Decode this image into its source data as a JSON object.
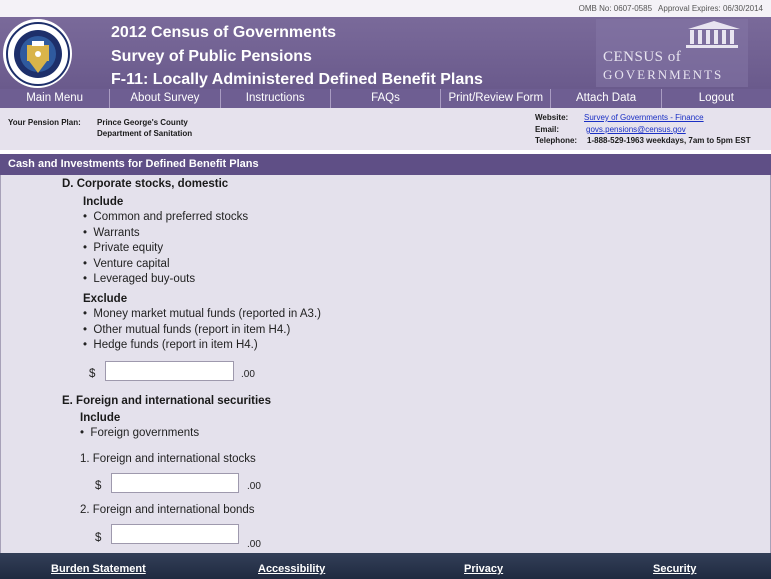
{
  "omb": {
    "number": "OMB No:  0607-0585",
    "expires": "Approval Expires:  06/30/2014"
  },
  "header": {
    "line1": "2012 Census of Governments",
    "line2": "Survey of Public Pensions",
    "line3": "F-11:  Locally Administered Defined Benefit Plans",
    "logo_line1": "CENSUS of",
    "logo_line2": "GOVERNMENTS"
  },
  "nav": [
    "Main Menu",
    "About Survey",
    "Instructions",
    "FAQs",
    "Print/Review Form",
    "Attach Data",
    "Logout"
  ],
  "plan": {
    "label": "Your Pension Plan:",
    "name1": "Prince George's County",
    "name2": "Department of Sanitation"
  },
  "contact": {
    "website_label": "Website:",
    "website": "Survey of Governments - Finance",
    "email_label": "Email:",
    "email": "govs.pensions@census.gov",
    "phone_label": "Telephone:",
    "phone": "1-888-529-1963  weekdays, 7am to 5pm EST"
  },
  "section_title": "Cash and Investments for Defined Benefit Plans",
  "item_d": {
    "title": "D.  Corporate stocks, domestic",
    "include_label": "Include",
    "include": [
      "Common and preferred stocks",
      "Warrants",
      "Private equity",
      "Venture capital",
      "Leveraged buy-outs"
    ],
    "exclude_label": "Exclude",
    "exclude": [
      "Money market mutual funds (reported in A3.)",
      "Other mutual funds (report in item H4.)",
      "Hedge funds (report in item H4.)"
    ],
    "currency": "$",
    "value": "",
    "cents": ".00"
  },
  "item_e": {
    "title": "E.  Foreign and international securities",
    "include_label": "Include",
    "include": [
      "Foreign governments"
    ],
    "sub1_label": "1.  Foreign and international stocks",
    "sub1_value": "",
    "sub2_label": "2.  Foreign and international bonds",
    "sub2_value": "",
    "currency": "$",
    "cents": ".00"
  },
  "footer": [
    "Burden Statement",
    "Accessibility",
    "Privacy",
    "Security"
  ]
}
